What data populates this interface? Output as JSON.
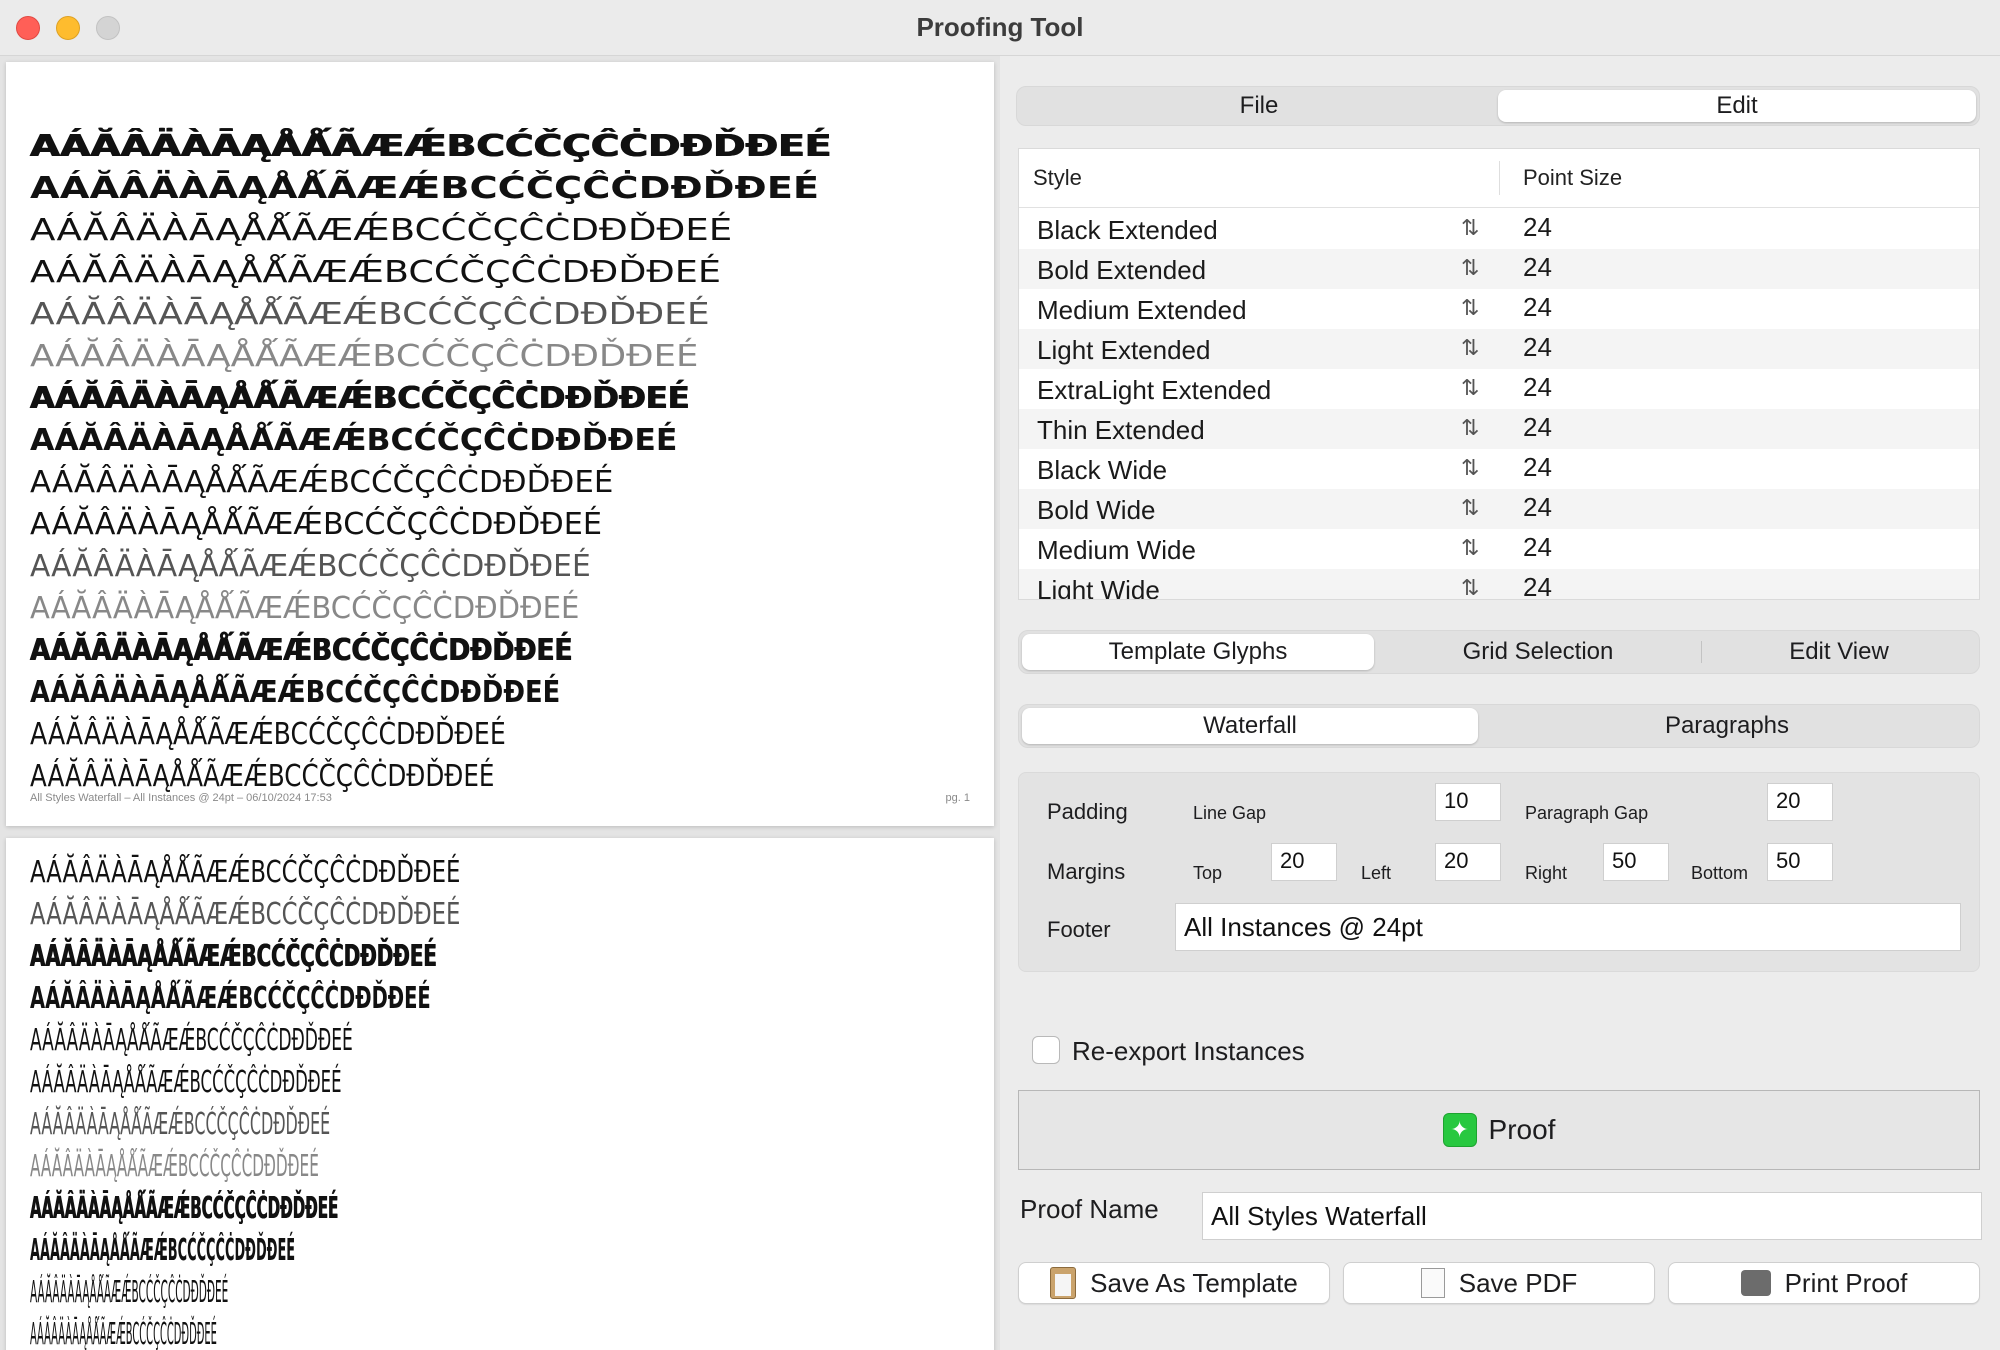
{
  "window": {
    "title": "Proofing Tool"
  },
  "glyph_sample": "AÁĂÂÄÀĀĄÅǺÃÆǼBCĆČÇĈĊDĐĎĐEÉ",
  "preview": {
    "footer_left": "All Styles Waterfall – All Instances @ 24pt – 06/10/2024 17:53",
    "footer_right": "pg. 1"
  },
  "tabs_top": [
    {
      "label": "File",
      "selected": false
    },
    {
      "label": "Edit",
      "selected": true
    }
  ],
  "styles_table": {
    "headers": {
      "style": "Style",
      "point_size": "Point Size"
    },
    "rows": [
      {
        "style": "Black Extended",
        "size": "24"
      },
      {
        "style": "Bold Extended",
        "size": "24"
      },
      {
        "style": "Medium Extended",
        "size": "24"
      },
      {
        "style": "Light Extended",
        "size": "24"
      },
      {
        "style": "ExtraLight Extended",
        "size": "24"
      },
      {
        "style": "Thin Extended",
        "size": "24"
      },
      {
        "style": "Black Wide",
        "size": "24"
      },
      {
        "style": "Bold Wide",
        "size": "24"
      },
      {
        "style": "Medium Wide",
        "size": "24"
      },
      {
        "style": "Light Wide",
        "size": "24"
      }
    ],
    "add_label": "+",
    "remove_label": "-"
  },
  "mode_tabs": [
    {
      "label": "Template Glyphs",
      "selected": true
    },
    {
      "label": "Grid Selection",
      "selected": false
    },
    {
      "label": "Edit View",
      "selected": false
    }
  ],
  "layout_tabs": [
    {
      "label": "Waterfall",
      "selected": true
    },
    {
      "label": "Paragraphs",
      "selected": false
    }
  ],
  "settings": {
    "padding_label": "Padding",
    "line_gap_label": "Line Gap",
    "line_gap": "10",
    "paragraph_gap_label": "Paragraph Gap",
    "paragraph_gap": "20",
    "margins_label": "Margins",
    "top_label": "Top",
    "top": "20",
    "left_label": "Left",
    "left": "20",
    "right_label": "Right",
    "right": "50",
    "bottom_label": "Bottom",
    "bottom": "50",
    "footer_label": "Footer",
    "footer": "All Instances @ 24pt"
  },
  "reexport_label": "Re-export Instances",
  "proof_button": "Proof",
  "proof_name_label": "Proof Name",
  "proof_name": "All Styles Waterfall",
  "buttons": {
    "save_template": "Save As Template",
    "save_pdf": "Save PDF",
    "print_proof": "Print Proof"
  },
  "icons": {
    "proof": "sparkle-icon",
    "template": "clipboard-icon",
    "pdf": "document-icon",
    "print": "printer-icon"
  },
  "colors": {
    "close": "#ff5f57",
    "minimize": "#febc2e",
    "proof_icon": "#28c840"
  }
}
